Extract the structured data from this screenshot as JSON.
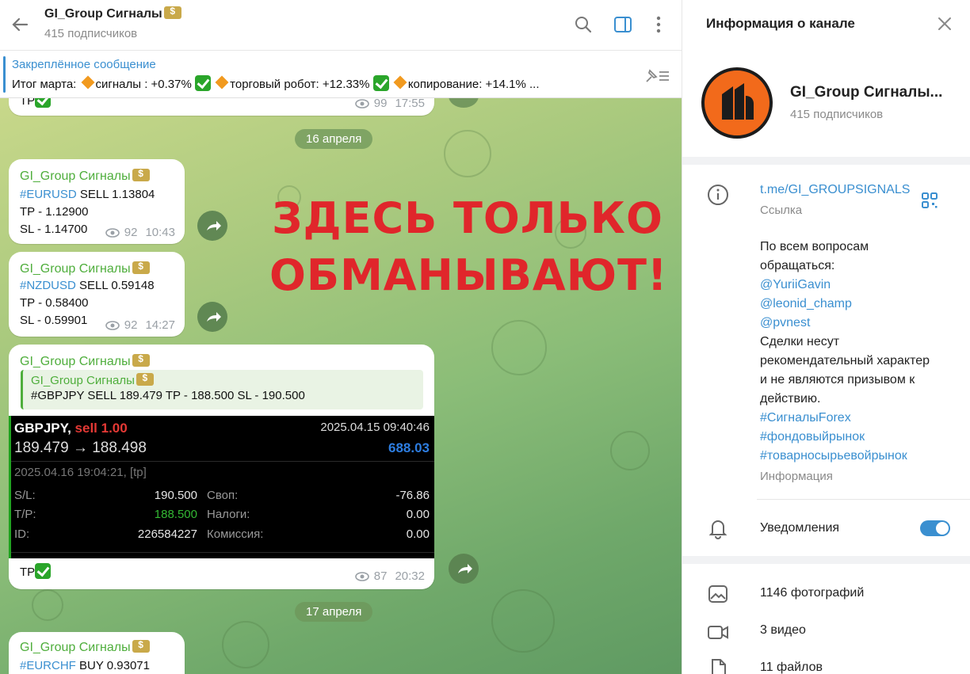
{
  "header": {
    "title": "GI_Group Сигналы",
    "subscribers": "415 подписчиков"
  },
  "pinned": {
    "title": "Закреплённое сообщение",
    "text_prefix": "Итог марта:",
    "part1": "сигналы : +0.37%",
    "part2": "торговый робот:  +12.33%",
    "part3": "копирование: +14.1% ..."
  },
  "messages": {
    "top": {
      "text": "TP",
      "views": "99",
      "time": "17:55"
    },
    "date1": "16 апреля",
    "m1": {
      "sender": "GI_Group Сигналы",
      "tag": "#EURUSD",
      "line1": " SELL 1.13804",
      "line2": "TP - 1.12900",
      "line3": "SL - 1.14700",
      "views": "92",
      "time": "10:43"
    },
    "m2": {
      "sender": "GI_Group Сигналы",
      "tag": "#NZDUSD",
      "line1": " SELL 0.59148",
      "line2": "TP - 0.58400",
      "line3": "SL - 0.59901",
      "views": "92",
      "time": "14:27"
    },
    "m3": {
      "sender": "GI_Group Сигналы",
      "quote_sender": "GI_Group Сигналы",
      "quote_text": "#GBPJPY SELL 189.479 TP - 188.500 SL - 190.500",
      "trade": {
        "symbol": "GBPJPY,",
        "side": "sell 1.00",
        "open_time": "2025.04.15 09:40:46",
        "prices": "189.479 → 188.498",
        "profit": "688.03",
        "close_time": "2025.04.16 19:04:21, [tp]",
        "sl_label": "S/L:",
        "sl_value": "190.500",
        "swap_label": "Своп:",
        "swap_value": "-76.86",
        "tp_label": "T/P:",
        "tp_value": "188.500",
        "tax_label": "Налоги:",
        "tax_value": "0.00",
        "id_label": "ID:",
        "id_value": "226584227",
        "comm_label": "Комиссия:",
        "comm_value": "0.00"
      },
      "text": "TP",
      "views": "87",
      "time": "20:32"
    },
    "date2": "17 апреля",
    "m4": {
      "sender": "GI_Group Сигналы",
      "tag": "#EURCHF",
      "line1": " BUY 0.93071"
    }
  },
  "overlay_warning": {
    "line1": "ЗДЕСЬ ТОЛЬКО",
    "line2": "ОБМАНЫВАЮТ!"
  },
  "panel": {
    "title": "Информация о канале",
    "name": "GI_Group Сигналы...",
    "subscribers": "415 подписчиков",
    "link": "t.me/GI_GROUPSIGNALS",
    "link_label": "Ссылка",
    "desc": [
      "По всем вопросам",
      "обращаться:",
      "@YuriiGavin",
      "@leonid_champ",
      "@pvnest",
      "Сделки несут",
      "рекомендательный характер",
      "и не являются призывом к",
      "действию.",
      "#СигналыForex",
      "#фондовыйрынок",
      "#товарносырьевойрынок"
    ],
    "info_label": "Информация",
    "notifications": "Уведомления",
    "notifications_on": true,
    "photos": "1146 фотографий",
    "videos": "3 видео",
    "files": "11 файлов"
  },
  "colors": {
    "accent": "#3a8fd0",
    "sender": "#4fae3c",
    "warning": "#e0262b",
    "avatar": "#f26a1b"
  }
}
